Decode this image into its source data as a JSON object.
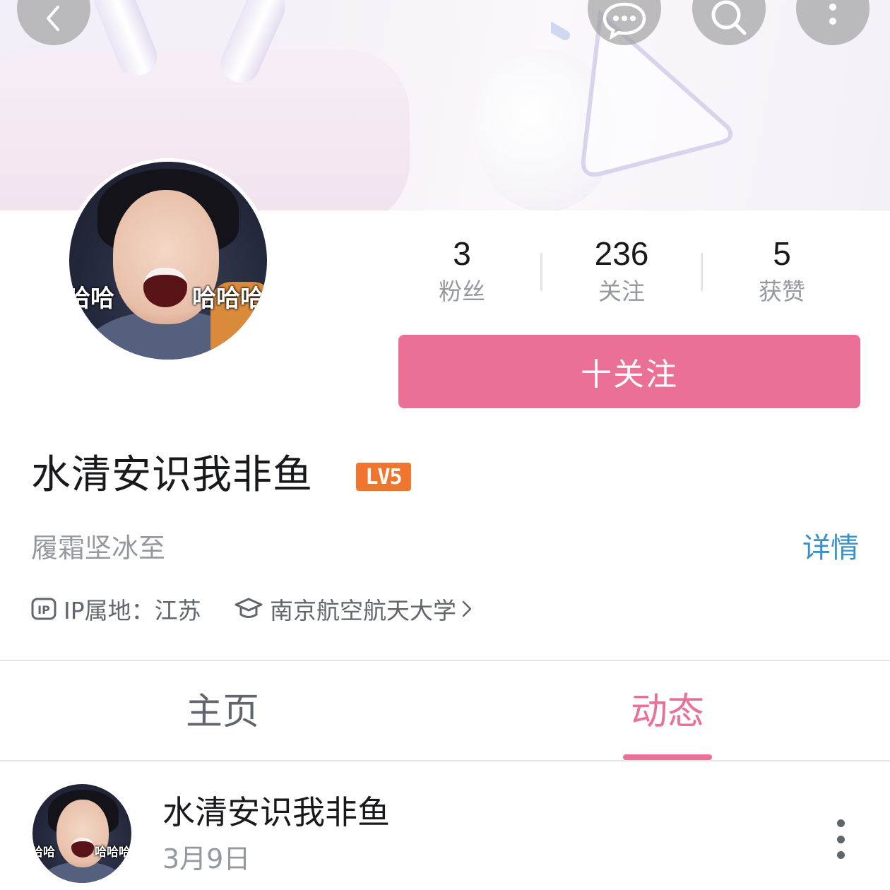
{
  "stats": [
    {
      "value": "3",
      "label": "粉丝"
    },
    {
      "value": "236",
      "label": "关注"
    },
    {
      "value": "5",
      "label": "获赞"
    }
  ],
  "follow_button": {
    "label": "十关注"
  },
  "profile": {
    "name": "水清安识我非鱼",
    "level_badge": "LV5",
    "signature": "履霜坚冰至",
    "detail_link": "详情",
    "ip_location": "IP属地：江苏",
    "school": "南京航空航天大学"
  },
  "avatar_overlay": {
    "left": "哈哈",
    "right": "哈哈哈"
  },
  "tabs": [
    {
      "label": "主页",
      "active": false
    },
    {
      "label": "动态",
      "active": true
    }
  ],
  "post": {
    "author": "水清安识我非鱼",
    "date": "3月9日",
    "avatar_overlay": {
      "left": "哈哈",
      "right": "哈哈哈"
    }
  },
  "colors": {
    "accent_pink": "#eb7096",
    "level_orange": "#f0762f",
    "link_blue": "#3a91c8",
    "text_gray": "#9499a0"
  },
  "icons": [
    "back-icon",
    "message-icon",
    "search-icon",
    "more-vertical-icon",
    "ip-icon",
    "graduation-cap-icon",
    "chevron-right-icon"
  ]
}
